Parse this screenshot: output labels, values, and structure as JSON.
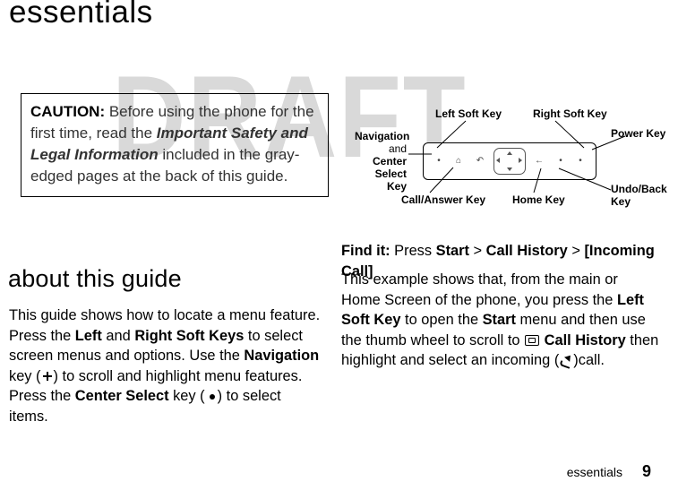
{
  "page": {
    "title": "essentials",
    "watermark": "DRAFT",
    "footer_label": "essentials",
    "page_number": "9"
  },
  "caution": {
    "lead": "CAUTION:",
    "part1": " Before using the phone for the first time, read the ",
    "emph": "Important Safety and Legal Information",
    "part2": " included in the gray-edged pages at the back of this guide."
  },
  "about": {
    "heading": "about this guide",
    "p1a": "This guide shows how to locate a menu feature. Press the ",
    "b1": "Left",
    "p1b": " and ",
    "b2": "Right Soft Keys",
    "p1c": " to select screen menus and options. Use the ",
    "b3": "Navigation",
    "p1d": " key (",
    "p1e": ") to scroll and highlight menu features. Press the ",
    "b4": "Center Select",
    "p1f": " key (",
    "p1g": ") to select items."
  },
  "findit": {
    "lead": "Find it:",
    "t1": " Press ",
    "b1": "Start",
    "sep": " > ",
    "b2": "Call History",
    "b3": "[Incoming Call]"
  },
  "explain": {
    "t1": "This example shows that, from the main or Home Screen of the phone, you press the ",
    "b1": "Left Soft Key",
    "t2": " to open the ",
    "b2": "Start",
    "t3": " menu and then use the thumb wheel to scroll to ",
    "b3": "Call History",
    "t4": " then highlight and select an incoming (",
    "t5": ")",
    "t6": "call."
  },
  "diagram": {
    "left_soft": "Left Soft Key",
    "right_soft": "Right Soft Key",
    "navigation": "Navigation",
    "and": "and ",
    "center_select": "Center Select Key",
    "power": "Power Key",
    "call_answer": "Call/Answer Key",
    "home": "Home Key",
    "undo_back": "Undo/Back Key"
  }
}
